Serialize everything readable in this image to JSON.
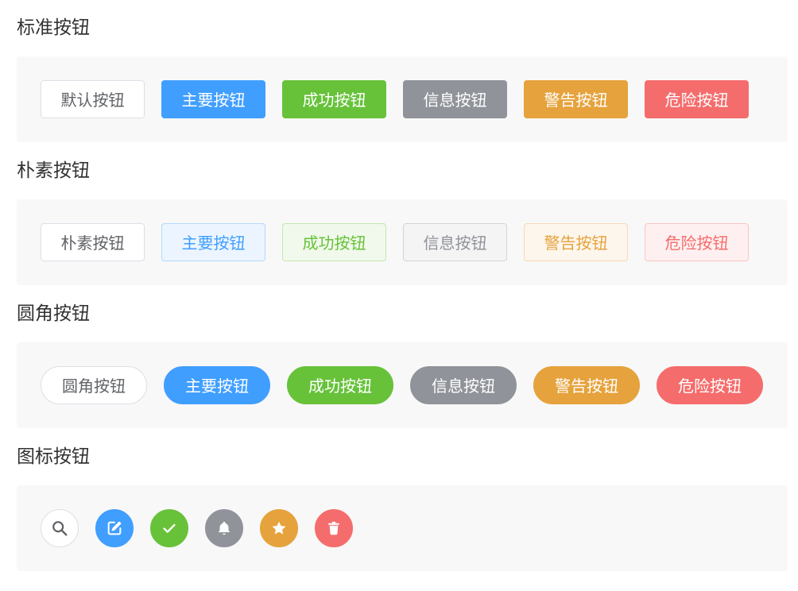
{
  "sections": {
    "standard": {
      "title": "标准按钮",
      "buttons": [
        "默认按钮",
        "主要按钮",
        "成功按钮",
        "信息按钮",
        "警告按钮",
        "危险按钮"
      ]
    },
    "plain": {
      "title": "朴素按钮",
      "buttons": [
        "朴素按钮",
        "主要按钮",
        "成功按钮",
        "信息按钮",
        "警告按钮",
        "危险按钮"
      ]
    },
    "round": {
      "title": "圆角按钮",
      "buttons": [
        "圆角按钮",
        "主要按钮",
        "成功按钮",
        "信息按钮",
        "警告按钮",
        "危险按钮"
      ]
    },
    "icon": {
      "title": "图标按钮",
      "icons": [
        "search-icon",
        "edit-icon",
        "check-icon",
        "bell-icon",
        "star-icon",
        "delete-icon"
      ]
    }
  },
  "colors": {
    "primary": "#409eff",
    "success": "#67c23a",
    "info": "#909399",
    "warning": "#e6a23c",
    "danger": "#f56c6c",
    "panel_bg": "#f8f8f8"
  }
}
